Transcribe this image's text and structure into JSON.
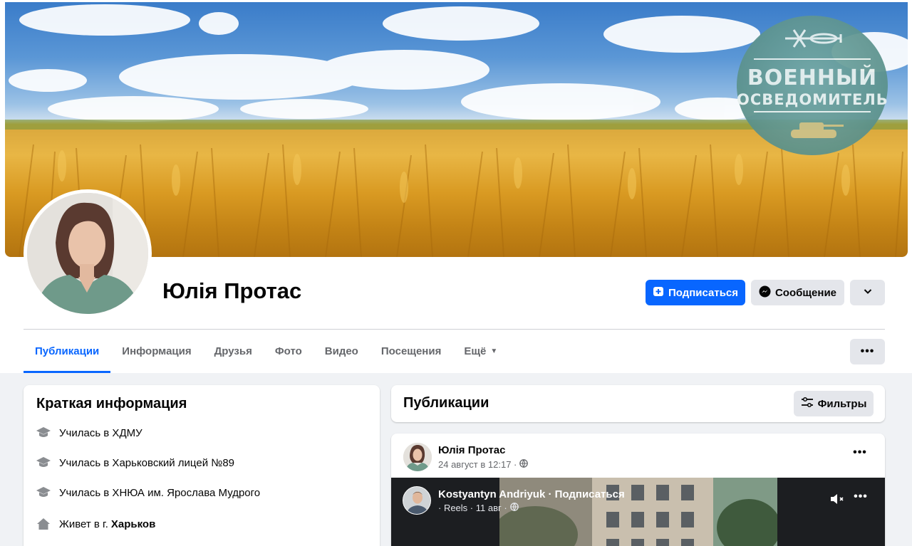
{
  "cover": {
    "badge_line1": "ВОЕННЫЙ",
    "badge_line2": "ОСВЕДОМИТЕЛЬ"
  },
  "profile": {
    "name": "Юлія Протас",
    "subscribe_label": "Подписаться",
    "message_label": "Сообщение"
  },
  "tabs": [
    {
      "label": "Публикации",
      "active": true
    },
    {
      "label": "Информация"
    },
    {
      "label": "Друзья"
    },
    {
      "label": "Фото"
    },
    {
      "label": "Видео"
    },
    {
      "label": "Посещения"
    },
    {
      "label": "Ещё"
    }
  ],
  "intro": {
    "title": "Краткая информация",
    "items": [
      {
        "text": "Училась в ХДМУ",
        "icon": "graduation-cap-icon"
      },
      {
        "text": "Училась в Харьковский лицей №89",
        "icon": "graduation-cap-icon"
      },
      {
        "text": "Училась в ХНЮА им. Ярослава Мудрого",
        "icon": "graduation-cap-icon"
      },
      {
        "prefix": "Живет в г.",
        "place": "Харьков",
        "icon": "home-icon"
      }
    ]
  },
  "posts": {
    "title": "Публикации",
    "filters_label": "Фильтры"
  },
  "post": {
    "author": "Юлія Протас",
    "date": "24 август в 12:17 ·",
    "shared": {
      "author": "Kostyantyn Andriyuk · Подписаться",
      "meta": "· Reels · 11 авг ·"
    }
  },
  "colors": {
    "accent": "#0866ff",
    "page_bg": "#f0f2f5",
    "secondary_button": "#e4e6eb",
    "muted_text": "#65676b"
  }
}
